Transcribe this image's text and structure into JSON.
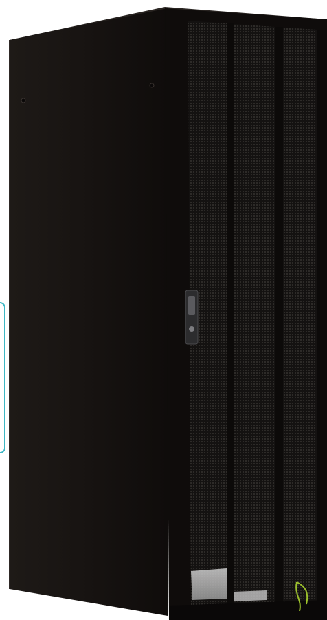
{
  "image": {
    "subject": "rack-cabinet",
    "colors": {
      "background": "#ffffff",
      "cabinet": "#1b1715",
      "side_panel": "#171311",
      "door_frame": "#0f0c0b",
      "mesh": "#2a2826",
      "accent_frame": "#3eb7c4",
      "handle": "#2c2c2e",
      "ground_cable": "#9bbf2c"
    },
    "icons": [
      "cabinet-handle-icon",
      "grounding-cable-icon"
    ]
  }
}
